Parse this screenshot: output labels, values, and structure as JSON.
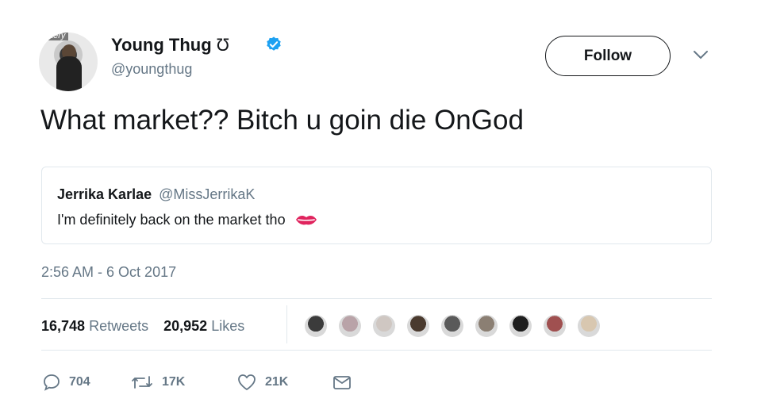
{
  "author": {
    "avatar_tag": "ttery",
    "name": "Young Thug",
    "name_symbol": "Ʊ",
    "handle": "@youngthug",
    "verified": true
  },
  "follow_button": {
    "label": "Follow"
  },
  "tweet": {
    "text": "What market?? Bitch u goin die OnGod"
  },
  "quoted_tweet": {
    "name": "Jerrika Karlae",
    "handle": "@MissJerrikaK",
    "text": "I'm definitely back on the market tho",
    "emoji_icon": "kiss-mark-icon"
  },
  "timestamp": "2:56 AM - 6 Oct 2017",
  "stats": {
    "retweets_count": "16,748",
    "retweets_label": "Retweets",
    "likes_count": "20,952",
    "likes_label": "Likes"
  },
  "likers": [
    "#3b3b3b",
    "#b9a3a8",
    "#cfc7c2",
    "#4a3a2e",
    "#5a5a5a",
    "#8b7f73",
    "#1e1e1e",
    "#a05050",
    "#d8c7b0"
  ],
  "actions": {
    "replies": "704",
    "retweets": "17K",
    "likes": "21K"
  },
  "colors": {
    "text": "#14171a",
    "secondary": "#657786",
    "verified_blue": "#1da1f2",
    "kiss_red": "#e0245e",
    "border": "#e1e8ed"
  }
}
